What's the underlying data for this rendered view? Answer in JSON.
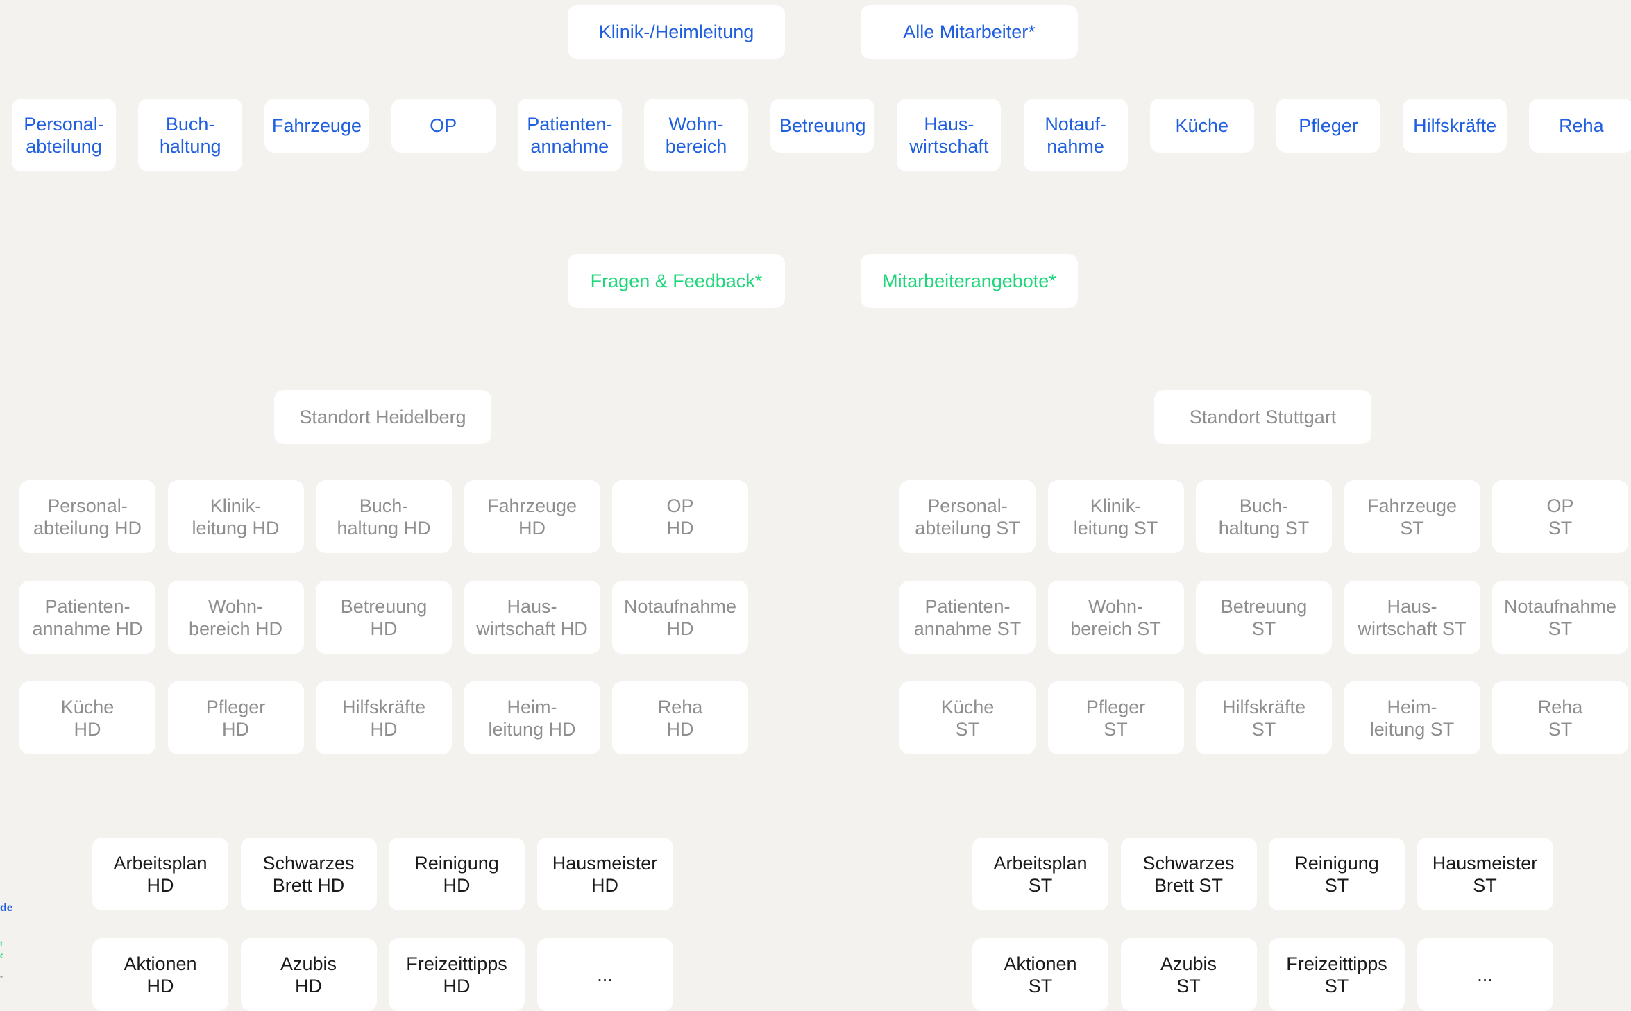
{
  "header": {
    "left": "Klinik-/Heimleitung",
    "right": "Alle Mitarbeiter*"
  },
  "departments": [
    "Personal-\nabteilung",
    "Buch-\nhaltung",
    "Fahrzeuge",
    "OP",
    "Patienten-\nannahme",
    "Wohn-\nbereich",
    "Betreuung",
    "Haus-\nwirtschaft",
    "Notauf-\nnahme",
    "Küche",
    "Pfleger",
    "Hilfskräfte",
    "Reha"
  ],
  "shared": {
    "left": "Fragen & Feedback*",
    "right": "Mitarbeiterangebote*"
  },
  "sites": {
    "hd": {
      "title": "Standort Heidelberg",
      "departments": [
        "Personal-\nabteilung HD",
        "Klinik-\nleitung HD",
        "Buch-\nhaltung  HD",
        "Fahrzeuge\nHD",
        "OP\nHD",
        "Patienten-\nannahme HD",
        "Wohn-\nbereich HD",
        "Betreuung\nHD",
        "Haus-\nwirtschaft HD",
        "Notaufnahme\nHD",
        "Küche\nHD",
        "Pfleger\nHD",
        "Hilfskräfte\nHD",
        "Heim-\nleitung HD",
        "Reha\nHD"
      ],
      "channels": [
        "Arbeitsplan\nHD",
        "Schwarzes\nBrett HD",
        "Reinigung\nHD",
        "Hausmeister\nHD",
        "Aktionen\nHD",
        "Azubis\nHD",
        "Freizeittipps\nHD",
        "..."
      ]
    },
    "st": {
      "title": "Standort Stuttgart",
      "departments": [
        "Personal-\nabteilung ST",
        "Klinik-\nleitung ST",
        "Buch-\nhaltung  ST",
        "Fahrzeuge\nST",
        "OP\nST",
        "Patienten-\nannahme ST",
        "Wohn-\nbereich ST",
        "Betreuung\nST",
        "Haus-\nwirtschaft ST",
        "Notaufnahme\nST",
        "Küche\nST",
        "Pfleger\nST",
        "Hilfskräfte\nST",
        "Heim-\nleitung ST",
        "Reha\nST"
      ],
      "channels": [
        "Arbeitsplan\nST",
        "Schwarzes\nBrett ST",
        "Reinigung\nST",
        "Hausmeister\nST",
        "Aktionen\nST",
        "Azubis\nST",
        "Freizeittipps\nST",
        "..."
      ]
    }
  },
  "edge_fragments": [
    "de",
    "n",
    "d",
    "-"
  ],
  "colors": {
    "background": "#f3f2ef",
    "card": "#ffffff",
    "top_level": "#1f5fe0",
    "shared": "#1fd67a",
    "site_level": "#8e8e8e",
    "channels": "#1a1a1a"
  }
}
